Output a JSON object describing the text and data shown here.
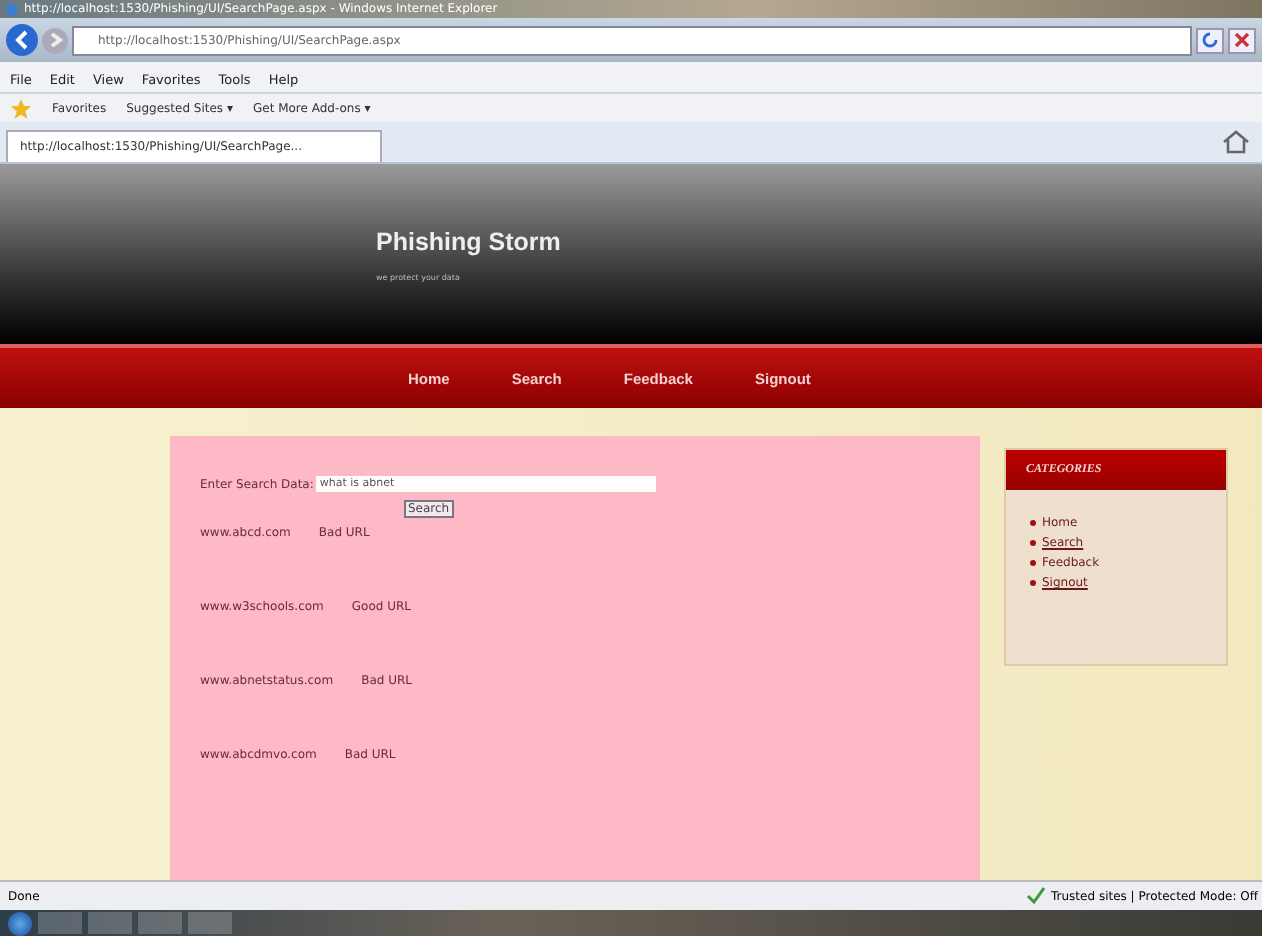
{
  "window": {
    "title": "http://localhost:1530/Phishing/UI/SearchPage.aspx - Windows Internet Explorer"
  },
  "address_bar": {
    "value": "http://localhost:1530/Phishing/UI/SearchPage.aspx"
  },
  "menu": [
    "File",
    "Edit",
    "View",
    "Favorites",
    "Tools",
    "Help"
  ],
  "favorites_bar": [
    "Favorites",
    "Suggested Sites ▾",
    "Get More Add-ons ▾"
  ],
  "tab": {
    "label": "http://localhost:1530/Phishing/UI/SearchPage..."
  },
  "site": {
    "title": "Phishing Storm",
    "subtitle": "we protect your data"
  },
  "nav": [
    "Home",
    "Search",
    "Feedback",
    "Signout"
  ],
  "search": {
    "label": "Enter Search Data:",
    "value": "what is abnet",
    "button": "Search"
  },
  "results": [
    {
      "url": "www.abcd.com",
      "verdict": "Bad URL"
    },
    {
      "url": "www.w3schools.com",
      "verdict": "Good URL"
    },
    {
      "url": "www.abnetstatus.com",
      "verdict": "Bad URL"
    },
    {
      "url": "www.abcdmvo.com",
      "verdict": "Bad URL"
    }
  ],
  "sidebar": {
    "title": "CATEGORIES",
    "items": [
      {
        "label": "Home",
        "underlined": false
      },
      {
        "label": "Search",
        "underlined": true
      },
      {
        "label": "Feedback",
        "underlined": false
      },
      {
        "label": "Signout",
        "underlined": true
      }
    ]
  },
  "status_bar": {
    "text": "Done",
    "zone": "Trusted sites | Protected Mode: Off"
  }
}
